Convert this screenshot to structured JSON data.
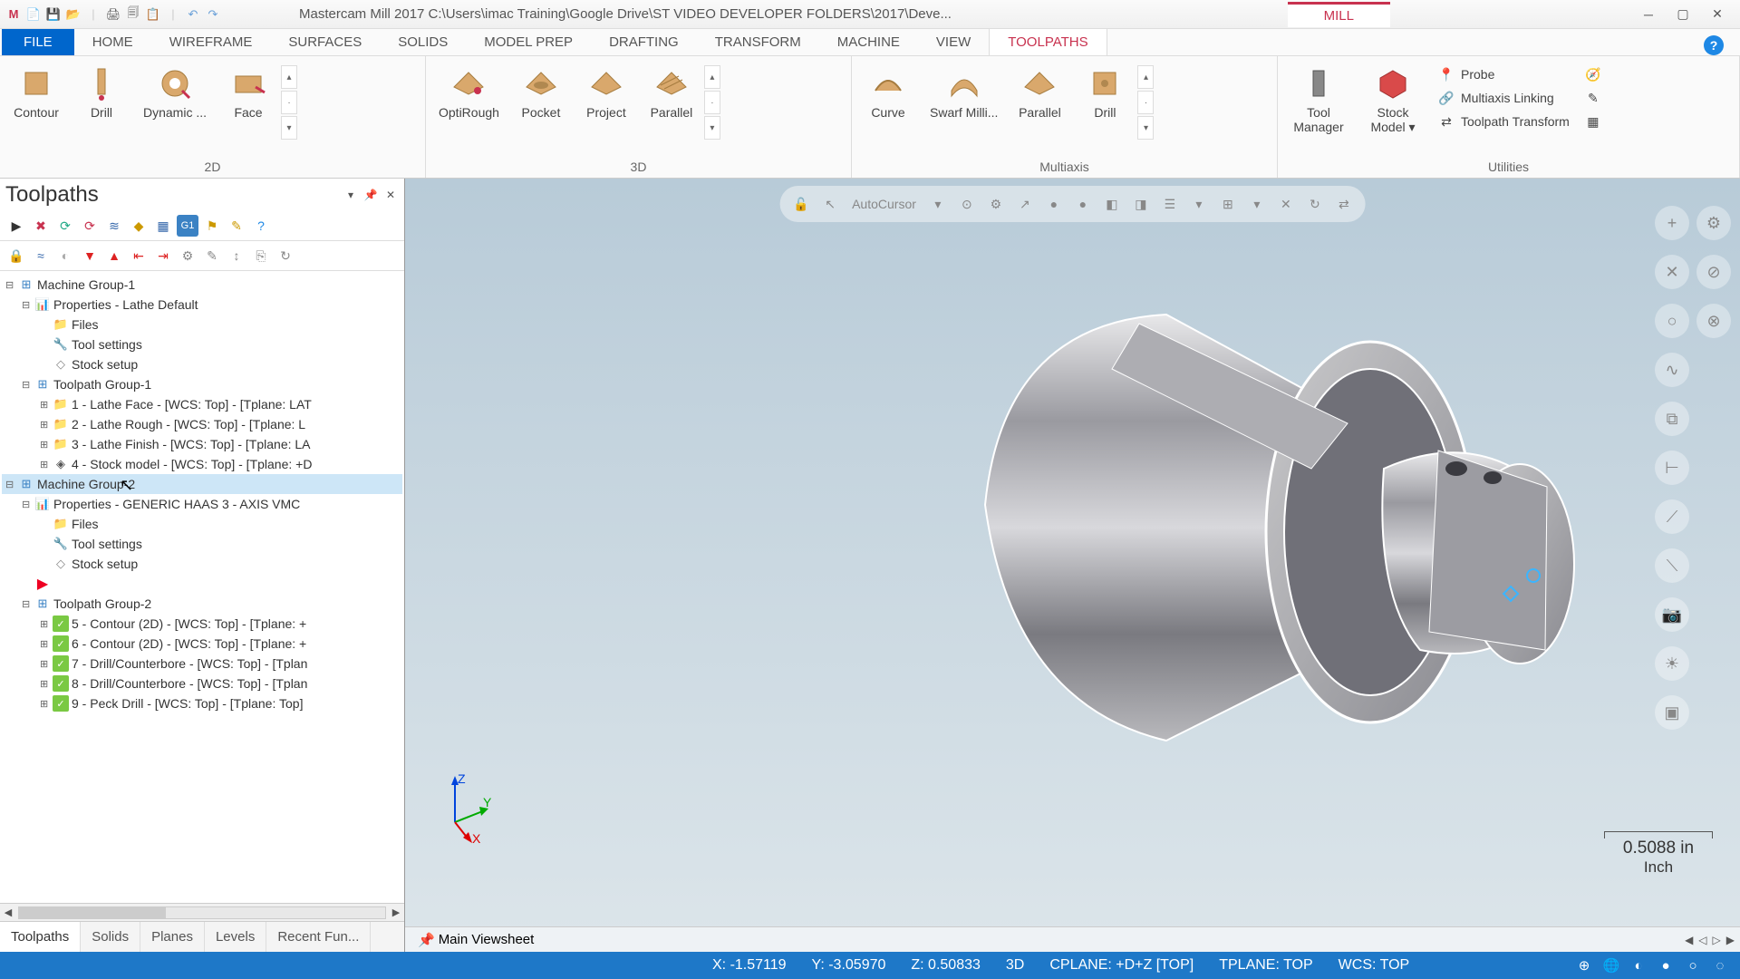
{
  "title": "Mastercam Mill 2017  C:\\Users\\imac Training\\Google Drive\\ST VIDEO DEVELOPER FOLDERS\\2017\\Deve...",
  "mill_tab": "MILL",
  "tabs": {
    "file": "FILE",
    "items": [
      "HOME",
      "WIREFRAME",
      "SURFACES",
      "SOLIDS",
      "MODEL PREP",
      "DRAFTING",
      "TRANSFORM",
      "MACHINE",
      "VIEW",
      "TOOLPATHS"
    ]
  },
  "ribbon": {
    "g2d": {
      "label": "2D",
      "items": [
        "Contour",
        "Drill",
        "Dynamic ...",
        "Face"
      ]
    },
    "g3d": {
      "label": "3D",
      "items": [
        "OptiRough",
        "Pocket",
        "Project",
        "Parallel"
      ]
    },
    "gmulti": {
      "label": "Multiaxis",
      "items": [
        "Curve",
        "Swarf Milli...",
        "Parallel",
        "Drill"
      ]
    },
    "gutil": {
      "label": "Utilities",
      "col1": [
        "Tool Manager",
        "Stock Model ▾"
      ],
      "col2": [
        "Probe",
        "Multiaxis Linking",
        "Toolpath Transform"
      ]
    }
  },
  "panel": {
    "title": "Toolpaths",
    "tree": {
      "mg1": "Machine Group-1",
      "prop1": "Properties - Lathe Default",
      "files": "Files",
      "toolset": "Tool settings",
      "stock": "Stock setup",
      "tg1": "Toolpath Group-1",
      "op1": "1 - Lathe Face - [WCS: Top] - [Tplane: LAT",
      "op2": "2 - Lathe Rough - [WCS: Top] - [Tplane: L",
      "op3": "3 - Lathe Finish - [WCS: Top] - [Tplane: LA",
      "op4": "4 - Stock model - [WCS: Top] - [Tplane: +D",
      "mg2": "Machine Group-2",
      "prop2": "Properties - GENERIC HAAS 3 - AXIS VMC",
      "tg2": "Toolpath Group-2",
      "op5": "5 - Contour (2D) - [WCS: Top] - [Tplane: +",
      "op6": "6 - Contour (2D) - [WCS: Top] - [Tplane: +",
      "op7": "7 - Drill/Counterbore - [WCS: Top] - [Tplan",
      "op8": "8 - Drill/Counterbore - [WCS: Top] - [Tplan",
      "op9": "9 - Peck Drill - [WCS: Top] - [Tplane: Top]"
    },
    "tabs": [
      "Toolpaths",
      "Solids",
      "Planes",
      "Levels",
      "Recent Fun..."
    ]
  },
  "viewport": {
    "autocursor": "AutoCursor",
    "scale_val": "0.5088 in",
    "scale_unit": "Inch",
    "viewsheet": "Main Viewsheet",
    "axis": {
      "x": "X",
      "y": "Y",
      "z": "Z"
    }
  },
  "status": {
    "x": "X:    -1.57119",
    "y": "Y:    -3.05970",
    "z": "Z:    0.50833",
    "mode": "3D",
    "cplane": "CPLANE: +D+Z [TOP]",
    "tplane": "TPLANE: TOP",
    "wcs": "WCS: TOP"
  }
}
